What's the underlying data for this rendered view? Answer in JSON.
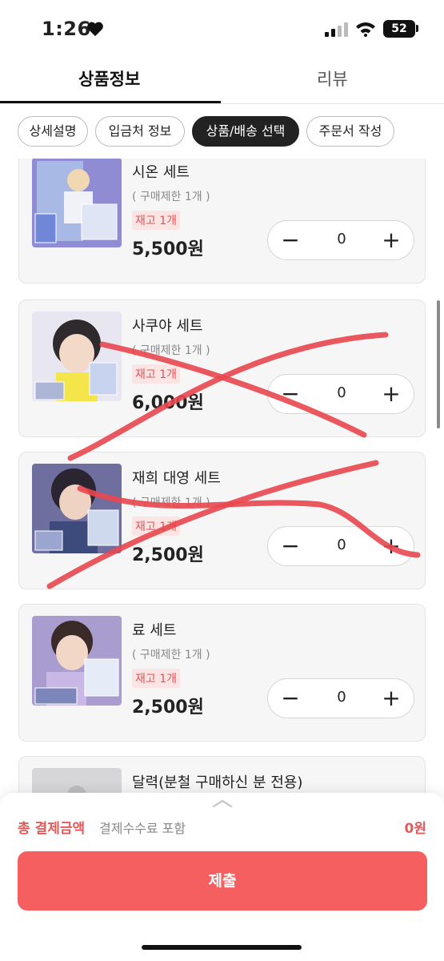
{
  "status_bar": {
    "time": "1:26",
    "battery": "52"
  },
  "tabs": {
    "info": "상품정보",
    "review": "리뷰"
  },
  "chips": [
    {
      "label": "상세설명"
    },
    {
      "label": "입금처 정보"
    },
    {
      "label": "상품/배송 선택"
    },
    {
      "label": "주문서 작성"
    }
  ],
  "products": [
    {
      "name": "시온 세트",
      "limit": "( 구매제한 1개 )",
      "stock": "재고 1개",
      "price": "5,500원",
      "qty": "0",
      "minus": "−",
      "plus": "+"
    },
    {
      "name": "사쿠야 세트",
      "limit": "( 구매제한 1개 )",
      "stock": "재고 1개",
      "price": "6,000원",
      "qty": "0",
      "minus": "−",
      "plus": "+"
    },
    {
      "name": "재희 대영 세트",
      "limit": "( 구매제한 1개 )",
      "stock": "재고 1개",
      "price": "2,500원",
      "qty": "0",
      "minus": "−",
      "plus": "+"
    },
    {
      "name": "료 세트",
      "limit": "( 구매제한 1개 )",
      "stock": "재고 1개",
      "price": "2,500원",
      "qty": "0",
      "minus": "−",
      "plus": "+"
    },
    {
      "name": "달력(분철 구매하신 분 전용)"
    }
  ],
  "footer": {
    "total_label": "총 결제금액",
    "total_sub": "결제수수료 포함",
    "total_value": "0원",
    "submit_label": "제출"
  },
  "colors": {
    "accent": "#f65f5f",
    "scribble": "#e8474e",
    "stock_bg": "#fde4e4"
  }
}
